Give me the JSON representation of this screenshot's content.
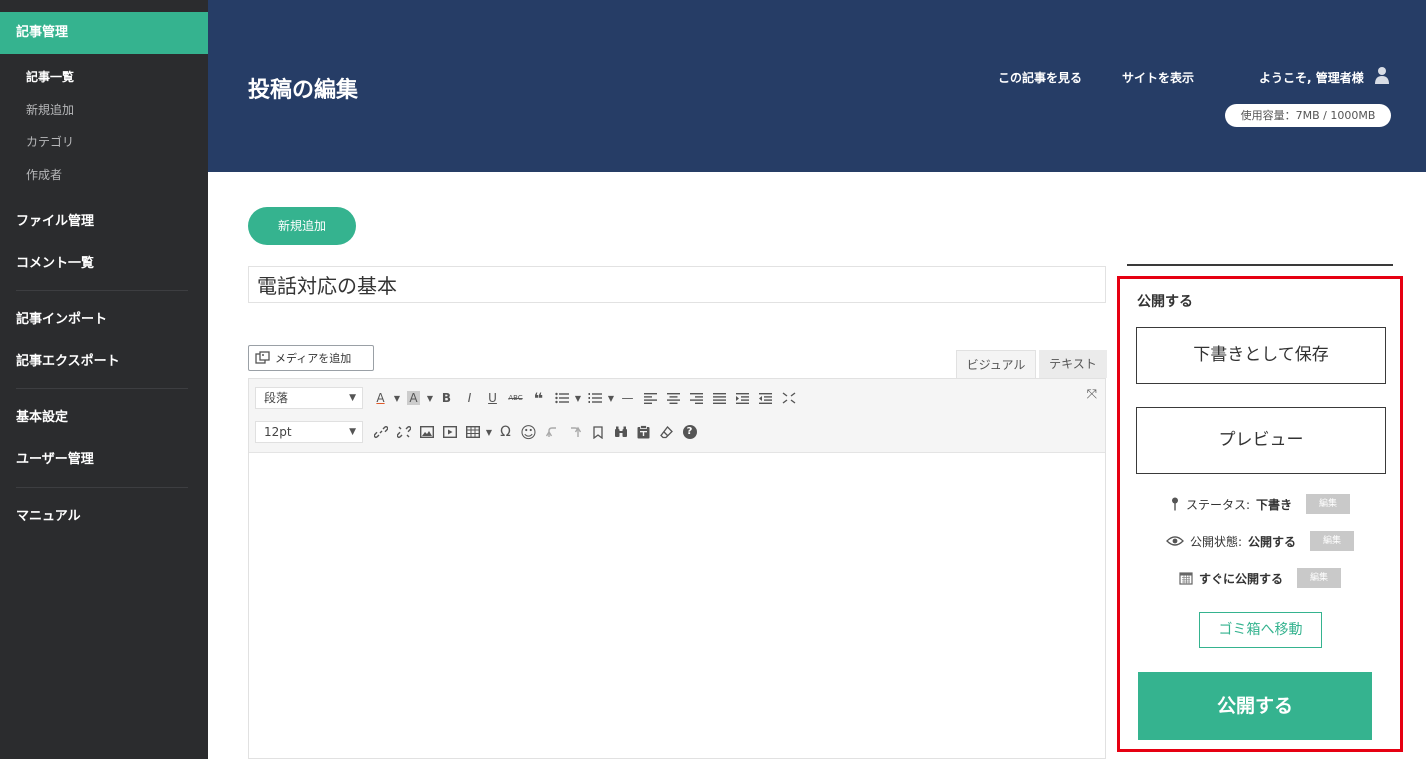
{
  "sidebar": {
    "active_section": "記事管理",
    "sub_items": [
      "記事一覧",
      "新規追加",
      "カテゴリ",
      "作成者"
    ],
    "items": [
      "ファイル管理",
      "コメント一覧",
      "記事インポート",
      "記事エクスポート",
      "基本設定",
      "ユーザー管理",
      "マニュアル"
    ]
  },
  "header": {
    "title": "投稿の編集",
    "view_post": "この記事を見る",
    "view_site": "サイトを表示",
    "welcome": "ようこそ, 管理者様",
    "capacity": "使用容量：7MB / 1000MB"
  },
  "main": {
    "add_new": "新規追加",
    "post_title": "電話対応の基本",
    "add_media": "メディアを追加",
    "tab_visual": "ビジュアル",
    "tab_text": "テキスト",
    "format_select": "段落",
    "size_select": "12pt",
    "toolbar_glyphs": {
      "bold": "B",
      "italic": "I",
      "underline": "U",
      "strike": "ABC",
      "quote": "❝",
      "omega": "Ω",
      "smile": "☺",
      "help": "?",
      "text_color": "A",
      "bg_color": "A",
      "hr": "—",
      "fullscreen": "⤧"
    }
  },
  "panel": {
    "heading": "公開する",
    "save_draft": "下書きとして保存",
    "preview": "プレビュー",
    "status_label": "ステータス:",
    "status_value": "下書き",
    "visibility_label": "公開状態:",
    "visibility_value": "公開する",
    "schedule": "すぐに公開する",
    "edit": "編集",
    "trash": "ゴミ箱へ移動",
    "publish": "公開する"
  },
  "colors": {
    "sidebar_bg": "#2b2c2e",
    "accent_green": "#35b38f",
    "header_bg": "#263d66",
    "highlight_red": "#e60012"
  }
}
